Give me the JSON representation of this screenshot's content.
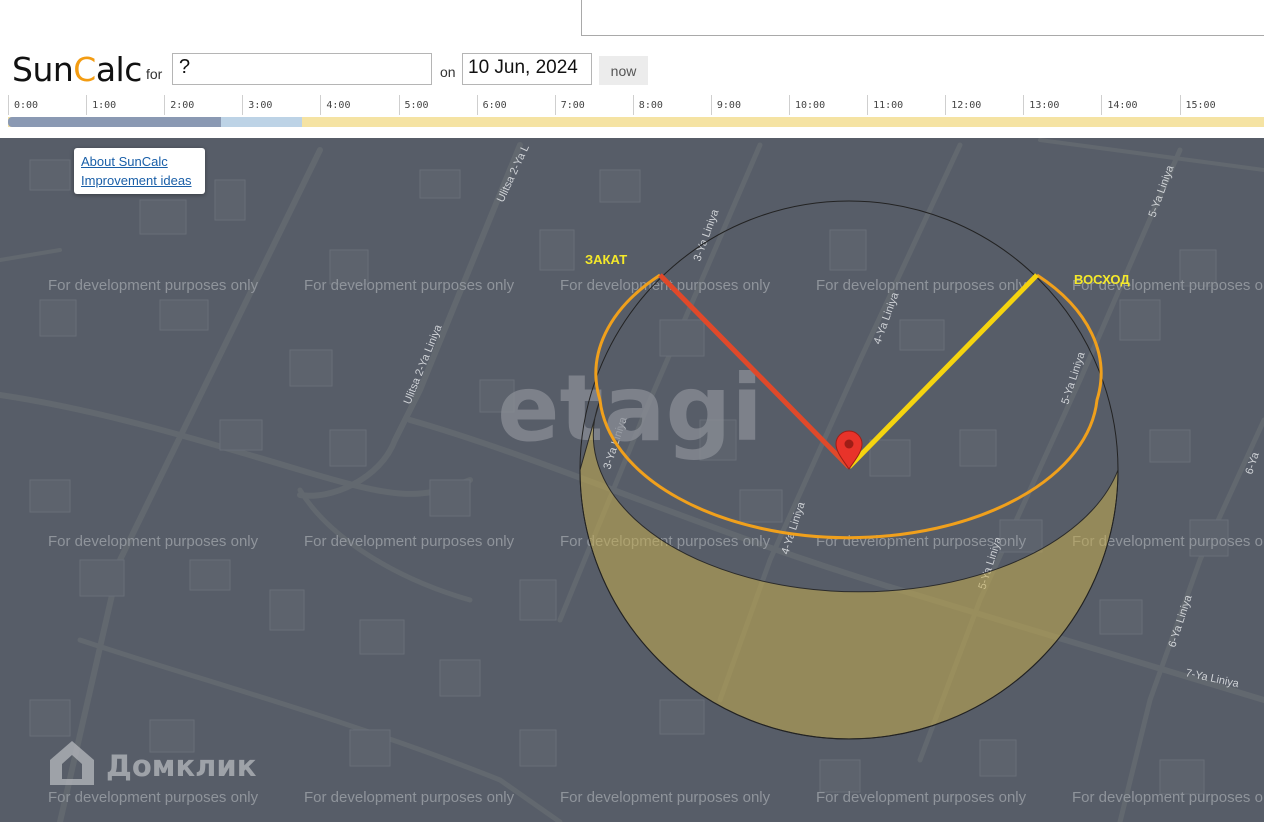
{
  "header": {
    "logo_part1": "Sun",
    "logo_part2": "C",
    "logo_part3": "alc",
    "for_label": "for",
    "address_value": "?",
    "on_label": "on",
    "date_value": "10 Jun, 2024",
    "now_label": "now"
  },
  "timeline": {
    "hours": [
      "0:00",
      "1:00",
      "2:00",
      "3:00",
      "4:00",
      "5:00",
      "6:00",
      "7:00",
      "8:00",
      "9:00",
      "10:00",
      "11:00",
      "12:00",
      "13:00",
      "14:00",
      "15:00"
    ],
    "colors": {
      "night": "#8a99b3",
      "twilight": "#bdd3e6",
      "day": "#f5e3a3"
    }
  },
  "info_links": {
    "about": "About SunCalc",
    "ideas": "Improvement ideas"
  },
  "map": {
    "sunset_label": "ЗАКАТ",
    "sunrise_label": "ВОСХОД",
    "watermark_center": "etagi",
    "watermark_brand": "Домклик",
    "dev_watermark": "For development purposes only",
    "streets": {
      "ulitsa_2ya_top": "Ulitsa 2-Ya L",
      "ulitsa_2ya_mid": "Ulitsa 2-Ya Liniya",
      "liniya_3": "3-Ya Liniya",
      "liniya_3b": "3-Ya Liniya",
      "liniya_4": "4-Ya Liniya",
      "liniya_4b": "4-Ya Liniya",
      "liniya_5": "5-Ya Liniya",
      "liniya_5b": "5-Ya Liniya",
      "liniya_5c": "5-Ya Liniya",
      "liniya_6": "6-Ya Liniya",
      "liniya_6b": "6-Ya",
      "liniya_7": "7-Ya Liniya"
    },
    "colors": {
      "sunset_line": "#e0492a",
      "sunrise_line": "#f5d40f",
      "sun_arc": "#f0a01c",
      "sun_area": "#c6ad4e",
      "marker": "#e8332a"
    }
  }
}
